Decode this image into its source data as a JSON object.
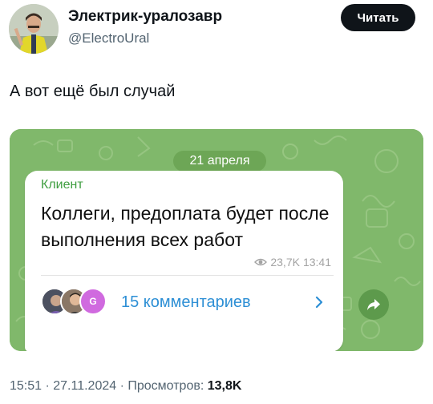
{
  "author": {
    "name": "Электрик-уралозавр",
    "handle": "@ElectroUral"
  },
  "follow_label": "Читать",
  "tweet_text": "А вот ещё был случай",
  "telegram": {
    "date": "21 апреля",
    "sender": "Клиент",
    "message": "Коллеги, предоплата будет после выполнения всех работ",
    "views": "23,7K",
    "time": "13:41",
    "comments_label": "15 комментариев",
    "commenter_initial": "G"
  },
  "footer": {
    "time_date": "15:51 · 27.11.2024 · Просмотров:",
    "views": "13,8K"
  },
  "colors": {
    "telegram_bg": "#7fb66a",
    "sender": "#3f9e40",
    "link": "#2d8fd5",
    "button": "#0f1419"
  }
}
